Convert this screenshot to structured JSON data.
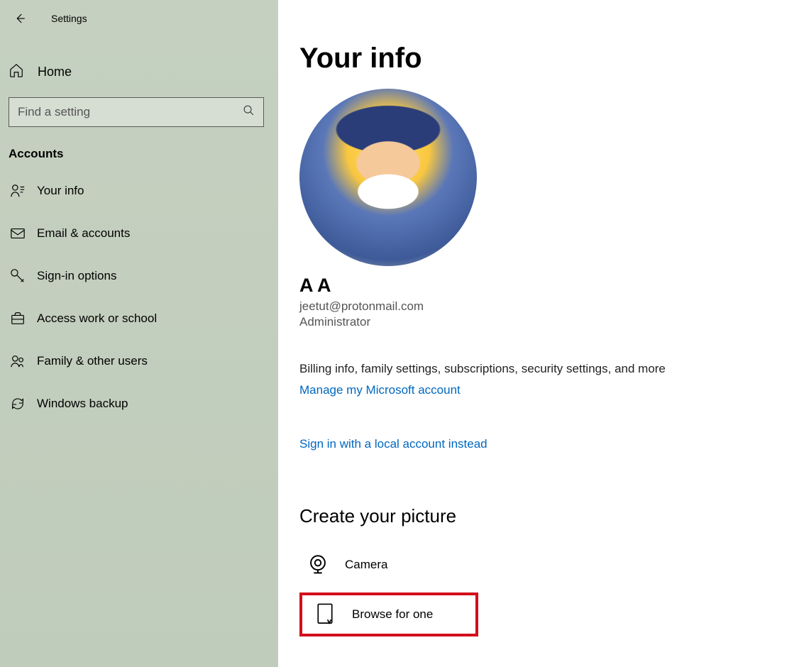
{
  "header": {
    "title": "Settings"
  },
  "sidebar": {
    "home_label": "Home",
    "search_placeholder": "Find a setting",
    "section_title": "Accounts",
    "items": [
      {
        "label": "Your info"
      },
      {
        "label": "Email & accounts"
      },
      {
        "label": "Sign-in options"
      },
      {
        "label": "Access work or school"
      },
      {
        "label": "Family & other users"
      },
      {
        "label": "Windows backup"
      }
    ]
  },
  "main": {
    "page_title": "Your info",
    "user_name": "A A",
    "user_email": "jeetut@protonmail.com",
    "user_role": "Administrator",
    "info_text": "Billing info, family settings, subscriptions, security settings, and more",
    "manage_link": "Manage my Microsoft account",
    "local_link": "Sign in with a local account instead",
    "create_picture_heading": "Create your picture",
    "camera_label": "Camera",
    "browse_label": "Browse for one"
  }
}
